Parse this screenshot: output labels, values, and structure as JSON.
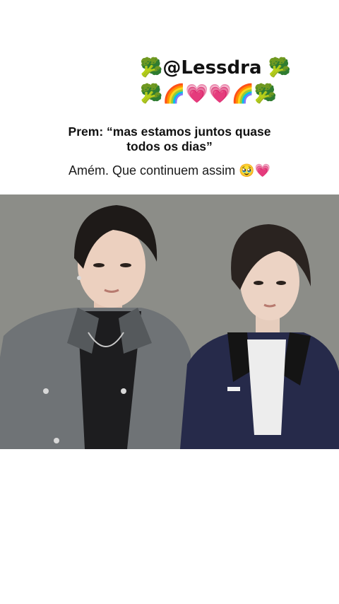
{
  "post": {
    "handle_line": "🥦@Lessdra 🥦",
    "emoji_line": "🥦🌈💗💗🌈🥦",
    "quote": "Prem: “mas estamos juntos quase todos os dias”",
    "caption": "Amém. Que continuem assim 🥹💗"
  },
  "colors": {
    "background": "#ffffff",
    "photo_backdrop": "#8c8d88",
    "denim_jacket": "#6f7376",
    "navy_jacket": "#262a4a"
  }
}
